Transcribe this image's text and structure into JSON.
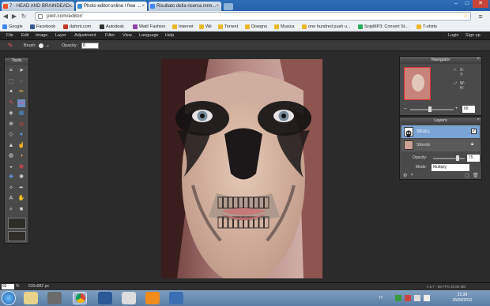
{
  "tabs": [
    {
      "label": "7 - HEAD AND BRAINDEAD...",
      "fav": "#f25022"
    },
    {
      "label": "Photo editor online / free ...",
      "fav": "#3b8ed6"
    },
    {
      "label": "Risultato della ricerca imm...",
      "fav": "#4285f4"
    }
  ],
  "window_controls": {
    "min": "–",
    "max": "□",
    "close": "✕"
  },
  "address": {
    "url": "pixlr.com/editor/"
  },
  "bookmarks": [
    {
      "label": "Google",
      "color": "#4285f4"
    },
    {
      "label": "Facebook",
      "color": "#3b5998"
    },
    {
      "label": "dafont.com",
      "color": "#c0392b"
    },
    {
      "label": "Autodesk",
      "color": "#333333"
    },
    {
      "label": "Wait! Fashion",
      "color": "#8e44ad"
    },
    {
      "label": "Internet",
      "color": "#e8b82a"
    },
    {
      "label": "Wii",
      "color": "#e8b82a"
    },
    {
      "label": "Torrent",
      "color": "#e8b82a"
    },
    {
      "label": "Disegno",
      "color": "#e8b82a"
    },
    {
      "label": "Musica",
      "color": "#e8b82a"
    },
    {
      "label": "one hundred push u...",
      "color": "#e8b82a"
    },
    {
      "label": "SnipMP3: Convert St...",
      "color": "#27ae60"
    },
    {
      "label": "T-shirts",
      "color": "#e8b82a"
    }
  ],
  "menu": [
    "File",
    "Edit",
    "Image",
    "Layer",
    "Adjustment",
    "Filter",
    "View",
    "Language",
    "Help"
  ],
  "account": {
    "login": "Login",
    "signup": "Sign up"
  },
  "options": {
    "brush_label": "Brush:",
    "opacity_label": "Opacity:",
    "opacity_value": "8"
  },
  "tools_panel": {
    "title": "Tools"
  },
  "navigator": {
    "title": "Navigator",
    "x_label": "X:",
    "y_label": "Y:",
    "w_label": "W:",
    "h_label": "H:",
    "zoom": "65"
  },
  "layers": {
    "title": "Layers",
    "items": [
      {
        "name": "SKULL",
        "selected": true
      },
      {
        "name": "Sfondo",
        "selected": false
      }
    ],
    "opacity_label": "Opacity:",
    "opacity_value": "75",
    "mode_label": "Mode:",
    "mode_value": "Multiply"
  },
  "status": {
    "zoom": "65",
    "unit": "%",
    "dimensions": "630x882 px",
    "fps": "v 6.7 - 88 FPS 28.65 MB"
  },
  "taskbar": {
    "lang": "IT",
    "time": "21:39",
    "date": "25/09/2012"
  },
  "colors": {
    "accent": "#6ea0d8",
    "workspace": "#2b2b2b",
    "panel": "#4a4a4a",
    "selected_layer": "#7ba4d4",
    "primary_color": "#2e2d28"
  }
}
